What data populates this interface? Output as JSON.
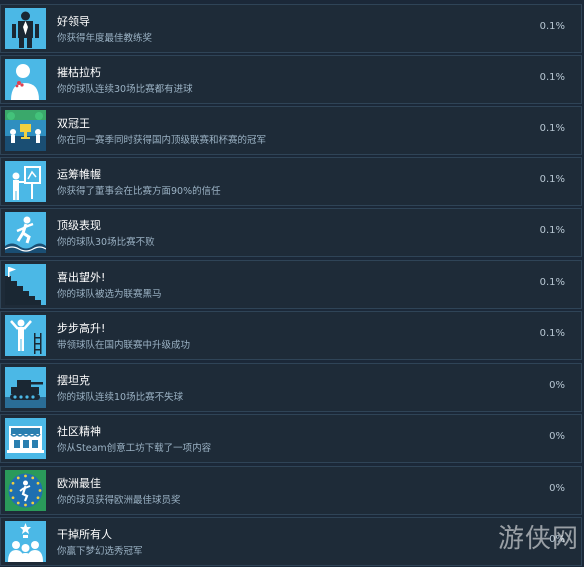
{
  "achievements": [
    {
      "name": "好领导",
      "desc": "你获得年度最佳教练奖",
      "pct": "0.1%",
      "icon": "leader-suit-icon"
    },
    {
      "name": "摧枯拉朽",
      "desc": "你的球队连续30场比赛都有进球",
      "pct": "0.1%",
      "icon": "smashing-man-icon"
    },
    {
      "name": "双冠王",
      "desc": "你在同一赛季同时获得国内顶级联赛和杯赛的冠军",
      "pct": "0.1%",
      "icon": "double-trophy-icon"
    },
    {
      "name": "运筹帷幄",
      "desc": "你获得了董事会在比赛方面90%的信任",
      "pct": "0.1%",
      "icon": "tactics-board-icon"
    },
    {
      "name": "顶级表现",
      "desc": "你的球队30场比赛不败",
      "pct": "0.1%",
      "icon": "surfer-icon"
    },
    {
      "name": "喜出望外!",
      "desc": "你的球队被选为联赛黑马",
      "pct": "0.1%",
      "icon": "stairs-flag-icon"
    },
    {
      "name": "步步高升!",
      "desc": "带领球队在国内联赛中升级成功",
      "pct": "0.1%",
      "icon": "ladder-climb-icon"
    },
    {
      "name": "摆坦克",
      "desc": "你的球队连续10场比赛不失球",
      "pct": "0%",
      "icon": "tank-icon"
    },
    {
      "name": "社区精神",
      "desc": "你从Steam创意工坊下载了一项内容",
      "pct": "0%",
      "icon": "workshop-shop-icon"
    },
    {
      "name": "欧洲最佳",
      "desc": "你的球员获得欧洲最佳球员奖",
      "pct": "0%",
      "icon": "euro-star-player-icon"
    },
    {
      "name": "干掉所有人",
      "desc": "你赢下梦幻选秀冠军",
      "pct": "0%",
      "icon": "crowd-trophy-icon"
    }
  ],
  "watermark": "游侠网"
}
